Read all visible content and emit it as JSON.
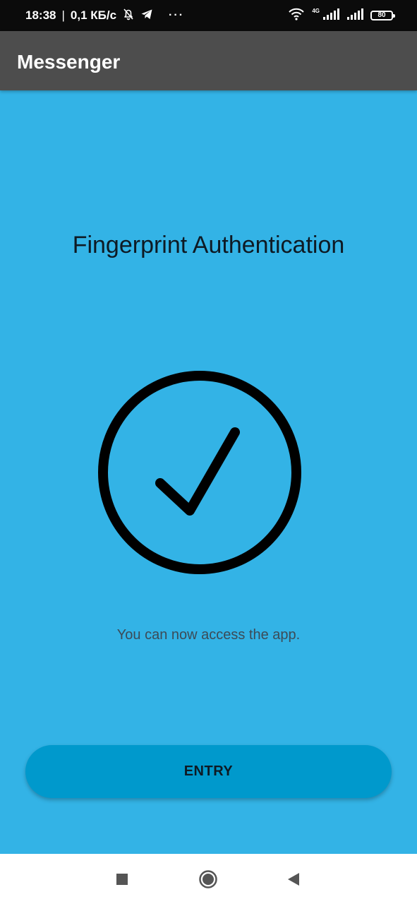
{
  "status_bar": {
    "time": "18:38",
    "separator": "|",
    "net_speed": "0,1 КБ/с",
    "more_dots": "···",
    "network_type": "4G",
    "battery": "80",
    "icons": [
      "bell-off-icon",
      "telegram-icon",
      "wifi-icon",
      "signal-icon",
      "signal-icon",
      "battery-icon"
    ]
  },
  "app_bar": {
    "title": "Messenger",
    "background": "#4d4d4d"
  },
  "main": {
    "heading": "Fingerprint Authentication",
    "status_icon": "check-circle-icon",
    "message": "You can now access the app.",
    "entry_button_label": "ENTRY",
    "background": "#33b3e6",
    "button_color": "#0099cc"
  },
  "nav_bar": {
    "buttons": [
      "recents-square-icon",
      "home-circle-icon",
      "back-triangle-icon"
    ]
  }
}
